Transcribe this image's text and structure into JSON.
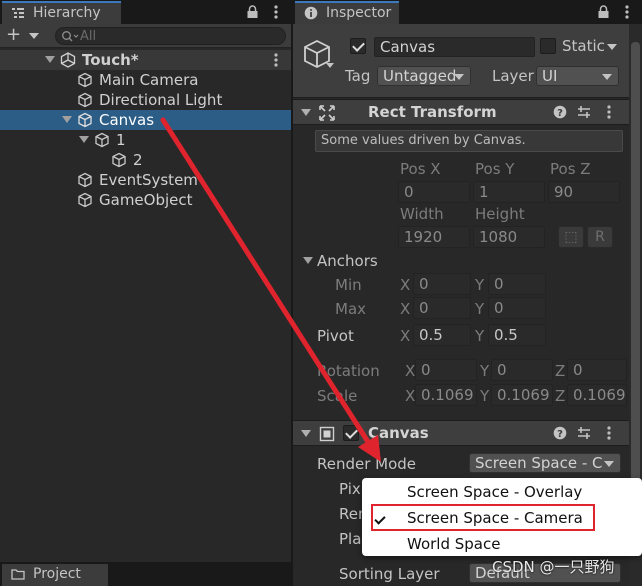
{
  "hierarchy": {
    "tab_label": "Hierarchy",
    "search_placeholder": "All",
    "rows": [
      {
        "label": "Touch*"
      },
      {
        "label": "Main Camera"
      },
      {
        "label": "Directional Light"
      },
      {
        "label": "Canvas"
      },
      {
        "label": "1"
      },
      {
        "label": "2"
      },
      {
        "label": "EventSystem"
      },
      {
        "label": "GameObject"
      }
    ]
  },
  "project": {
    "tab_label": "Project"
  },
  "inspector": {
    "tab_label": "Inspector",
    "object_name": "Canvas",
    "static_label": "Static",
    "tag_label": "Tag",
    "tag_value": "Untagged",
    "layer_label": "Layer",
    "layer_value": "UI"
  },
  "rect_transform": {
    "title": "Rect Transform",
    "info": "Some values driven by Canvas.",
    "pos_x_label": "Pos X",
    "pos_y_label": "Pos Y",
    "pos_z_label": "Pos Z",
    "pos_x": "0",
    "pos_y": "1",
    "pos_z": "90",
    "width_label": "Width",
    "height_label": "Height",
    "width": "1920",
    "height": "1080",
    "blueprint_button": "⬚",
    "raw_button": "R",
    "anchors_label": "Anchors",
    "min_label": "Min",
    "max_label": "Max",
    "x_label": "X",
    "y_label": "Y",
    "z_label": "Z",
    "min_x": "0",
    "min_y": "0",
    "max_x": "0",
    "max_y": "0",
    "pivot_label": "Pivot",
    "pivot_x": "0.5",
    "pivot_y": "0.5",
    "rotation_label": "Rotation",
    "rot_x": "0",
    "rot_y": "0",
    "rot_z": "0",
    "scale_label": "Scale",
    "scale_x": "0.1069",
    "scale_y": "0.1069",
    "scale_z": "0.1069"
  },
  "canvas_component": {
    "title": "Canvas",
    "render_mode_label": "Render Mode",
    "render_mode_value": "Screen Space - C",
    "pixel_perfect_label": "Pix",
    "render_camera_label": "Ren",
    "plane_distance_label": "Pla",
    "sorting_layer_label": "Sorting Layer",
    "sorting_layer_value": "Default"
  },
  "render_mode_popup": {
    "options": [
      "Screen Space - Overlay",
      "Screen Space - Camera",
      "World Space"
    ],
    "selected": "Screen Space - Camera"
  },
  "watermark": "CSDN @一只野狗",
  "colors": {
    "selection": "#2c5d87",
    "tab_accent": "#3a79bb",
    "annotation": "#e0242e"
  }
}
